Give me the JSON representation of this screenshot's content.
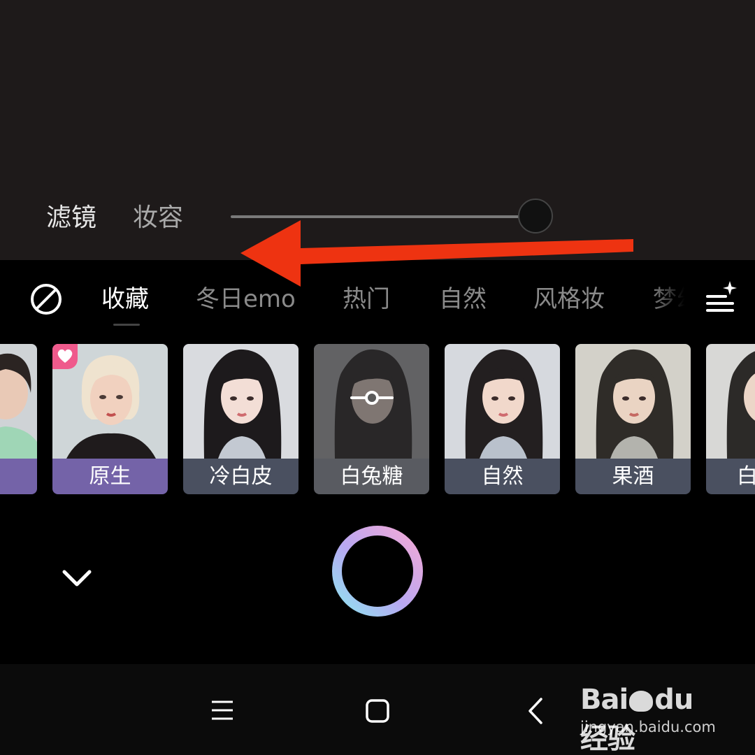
{
  "mode_tabs": [
    {
      "label": "滤镜",
      "active": true
    },
    {
      "label": "妆容",
      "active": false
    }
  ],
  "slider": {
    "value_fraction": 1.0
  },
  "annotation": {
    "arrow_color": "#ee3311",
    "direction": "left"
  },
  "categories": [
    {
      "label": "收藏",
      "active": true
    },
    {
      "label": "冬日emo",
      "active": false
    },
    {
      "label": "热门",
      "active": false
    },
    {
      "label": "自然",
      "active": false
    },
    {
      "label": "风格妆",
      "active": false
    },
    {
      "label": "梦幻",
      "active": false
    }
  ],
  "filters": [
    {
      "label": "",
      "partial": true
    },
    {
      "label": "原生",
      "favorite": true
    },
    {
      "label": "冷白皮"
    },
    {
      "label": "白兔糖",
      "selected": true
    },
    {
      "label": "自然"
    },
    {
      "label": "果酒"
    },
    {
      "label": "白",
      "partial": true
    }
  ],
  "icons": {
    "no_filter": "no-filter-icon",
    "category_menu": "filter-menu-sparkle-icon",
    "collapse": "chevron-down-icon",
    "shutter": "shutter-ring-button",
    "nav_menu": "hamburger-menu-icon",
    "nav_home": "home-square-icon",
    "nav_back": "back-chevron-icon"
  },
  "colors": {
    "accent_purple": "#7463a8",
    "label_gray": "#4a5060",
    "heart_pink": "#ef5a8c"
  },
  "watermark": {
    "logo": "Bai du 经验",
    "url": "jingyan.baidu.com"
  }
}
